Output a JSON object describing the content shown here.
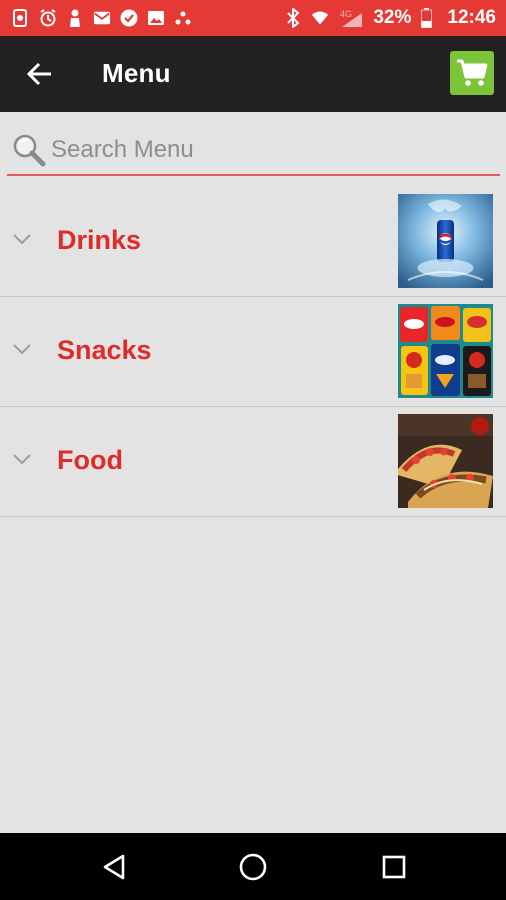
{
  "status_bar": {
    "left_icons": [
      "file-sync-icon",
      "alarm-icon",
      "person-icon",
      "mail-icon",
      "check-badge-icon",
      "image-icon",
      "network-dots-icon"
    ],
    "battery_text": "32%",
    "time": "12:46",
    "network_label": "4G",
    "background": "#e53935"
  },
  "app_bar": {
    "title": "Menu",
    "background": "#222222",
    "cart_color": "#7cc43a"
  },
  "search": {
    "placeholder": "Search Menu",
    "underline_color": "#e45a5a"
  },
  "categories": [
    {
      "label": "Drinks",
      "image": "pepsi-can-image"
    },
    {
      "label": "Snacks",
      "image": "chips-bags-image"
    },
    {
      "label": "Food",
      "image": "tacos-image"
    }
  ],
  "accent_text_color": "#e02b2b"
}
